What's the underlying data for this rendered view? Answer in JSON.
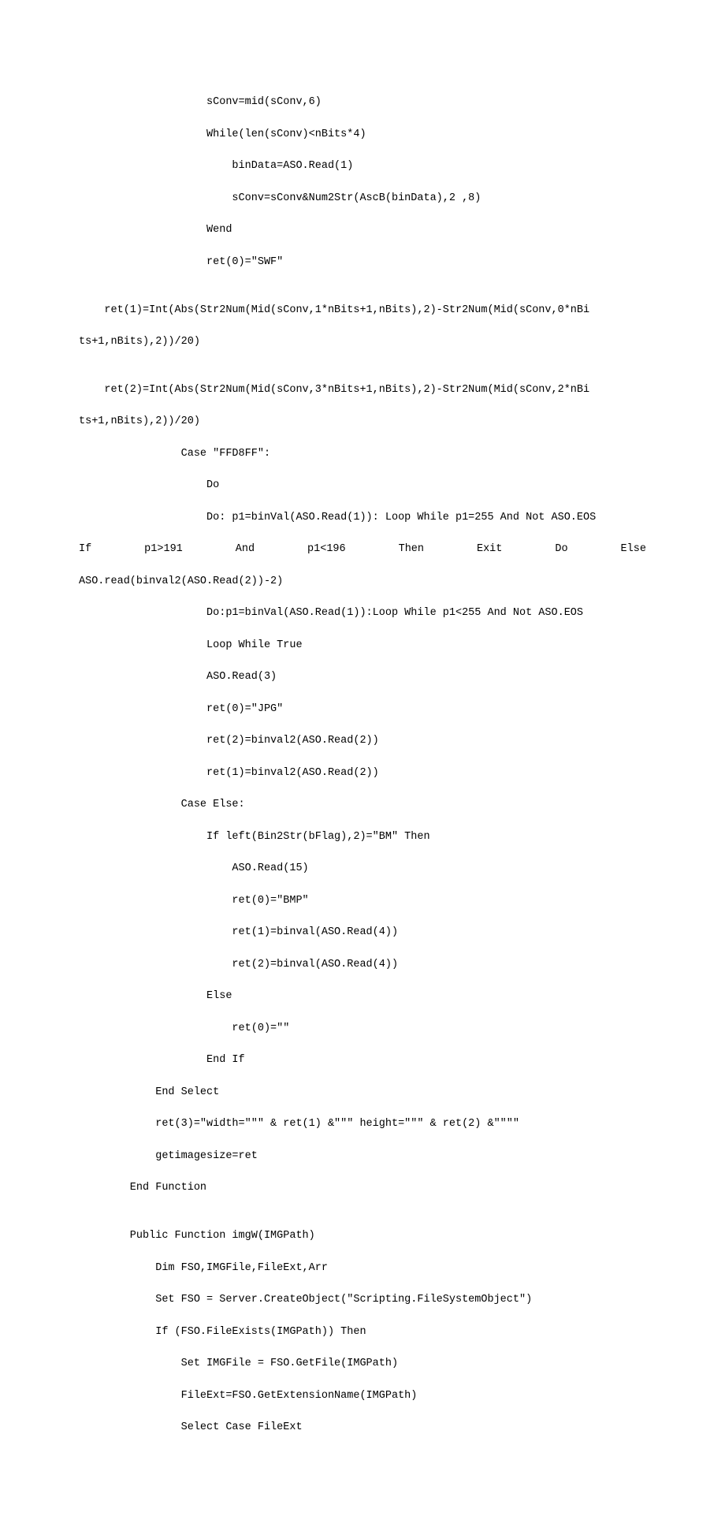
{
  "lines": {
    "l1": "                    sConv=mid(sConv,6)",
    "l2": "                    While(len(sConv)<nBits*4)",
    "l3": "                        binData=ASO.Read(1)",
    "l4": "                        sConv=sConv&Num2Str(AscB(binData),2 ,8)",
    "l5": "                    Wend",
    "l6": "                    ret(0)=\"SWF\"",
    "l7": "",
    "l8": "    ret(1)=Int(Abs(Str2Num(Mid(sConv,1*nBits+1,nBits),2)-Str2Num(Mid(sConv,0*nBi",
    "l9": "ts+1,nBits),2))/20)",
    "l10": "",
    "l11": "    ret(2)=Int(Abs(Str2Num(Mid(sConv,3*nBits+1,nBits),2)-Str2Num(Mid(sConv,2*nBi",
    "l12": "ts+1,nBits),2))/20)",
    "l13": "                Case \"FFD8FF\":",
    "l14": "                    Do",
    "l15": "                    Do: p1=binVal(ASO.Read(1)): Loop While p1=255 And Not ASO.EOS",
    "l17": "ASO.read(binval2(ASO.Read(2))-2)",
    "l18": "                    Do:p1=binVal(ASO.Read(1)):Loop While p1<255 And Not ASO.EOS",
    "l19": "                    Loop While True",
    "l20": "                    ASO.Read(3)",
    "l21": "                    ret(0)=\"JPG\"",
    "l22": "                    ret(2)=binval2(ASO.Read(2))",
    "l23": "                    ret(1)=binval2(ASO.Read(2))",
    "l24": "                Case Else:",
    "l25": "                    If left(Bin2Str(bFlag),2)=\"BM\" Then",
    "l26": "                        ASO.Read(15)",
    "l27": "                        ret(0)=\"BMP\"",
    "l28": "                        ret(1)=binval(ASO.Read(4))",
    "l29": "                        ret(2)=binval(ASO.Read(4))",
    "l30": "                    Else",
    "l31": "                        ret(0)=\"\"",
    "l32": "                    End If",
    "l33": "            End Select",
    "l34": "            ret(3)=\"width=\"\"\" & ret(1) &\"\"\" height=\"\"\" & ret(2) &\"\"\"\"",
    "l35": "            getimagesize=ret",
    "l36": "        End Function",
    "l37": "",
    "l38": "        Public Function imgW(IMGPath)",
    "l39": "            Dim FSO,IMGFile,FileExt,Arr",
    "l40": "            Set FSO = Server.CreateObject(\"Scripting.FileSystemObject\")",
    "l41": "            If (FSO.FileExists(IMGPath)) Then",
    "l42": "                Set IMGFile = FSO.GetFile(IMGPath)",
    "l43": "                FileExt=FSO.GetExtensionName(IMGPath)",
    "l44": "                Select Case FileExt"
  },
  "justified": {
    "w1": "                    If",
    "w2": "p1>191",
    "w3": "And",
    "w4": "p1<196",
    "w5": "Then",
    "w6": "Exit",
    "w7": "Do",
    "w8": "Else"
  }
}
